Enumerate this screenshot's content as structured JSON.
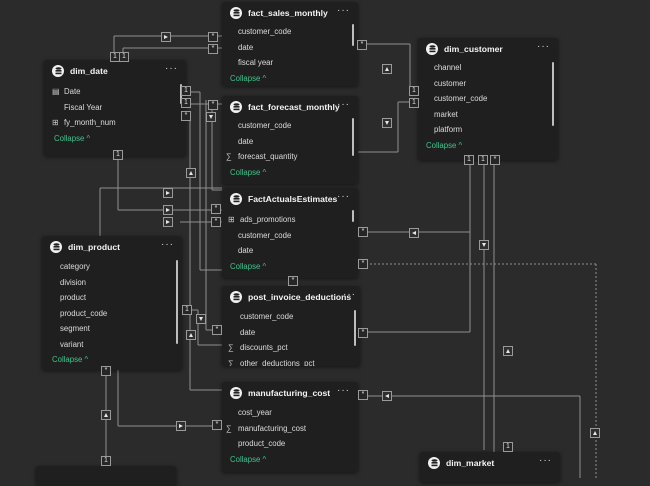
{
  "model_view": {
    "tables": {
      "fact_sales_monthly": {
        "title": "fact_sales_monthly",
        "more": "···",
        "fields": [
          "customer_code",
          "date",
          "fiscal year"
        ],
        "collapse": "Collapse ^"
      },
      "dim_customer": {
        "title": "dim_customer",
        "more": "···",
        "fields": [
          "channel",
          "customer",
          "customer_code",
          "market",
          "platform"
        ],
        "collapse": "Collapse ^"
      },
      "dim_date": {
        "title": "dim_date",
        "more": "···",
        "fields": [
          "Date",
          "Fiscal Year",
          "fy_month_num"
        ],
        "collapse": "Collapse ^"
      },
      "fact_forecast_monthly": {
        "title": "fact_forecast_monthly",
        "more": "···",
        "fields": [
          "customer_code",
          "date",
          "forecast_quantity"
        ],
        "collapse": "Collapse ^"
      },
      "fact_actuals_estimates": {
        "title": "FactActualsEstimates",
        "more": "···",
        "fields": [
          "ads_promotions",
          "customer_code",
          "date"
        ],
        "collapse": "Collapse ^"
      },
      "dim_product": {
        "title": "dim_product",
        "more": "···",
        "fields": [
          "category",
          "division",
          "product",
          "product_code",
          "segment",
          "variant"
        ],
        "collapse": "Collapse ^"
      },
      "post_invoice_deductions": {
        "title": "post_invoice_deductions",
        "more": "···",
        "fields": [
          "customer_code",
          "date",
          "discounts_pct",
          "other_deductions_pct"
        ]
      },
      "manufacturing_cost": {
        "title": "manufacturing_cost",
        "more": "···",
        "fields": [
          "cost_year",
          "manufacturing_cost",
          "product_code"
        ],
        "collapse": "Collapse ^"
      },
      "dim_market": {
        "title": "dim_market",
        "more": "···"
      }
    },
    "cardinality": {
      "one": "1",
      "many": "*"
    },
    "colors": {
      "canvas": "#2b2b2b",
      "card": "#1f1f1f",
      "collapse_link": "#3fc48c",
      "relationship_line": "#8f8f8f"
    },
    "icons": {
      "table": "table-icon",
      "date": "calendar-icon",
      "hierarchy": "hierarchy-icon",
      "measure": "sigma-icon",
      "calculated_table": "calculated-table-icon"
    }
  }
}
